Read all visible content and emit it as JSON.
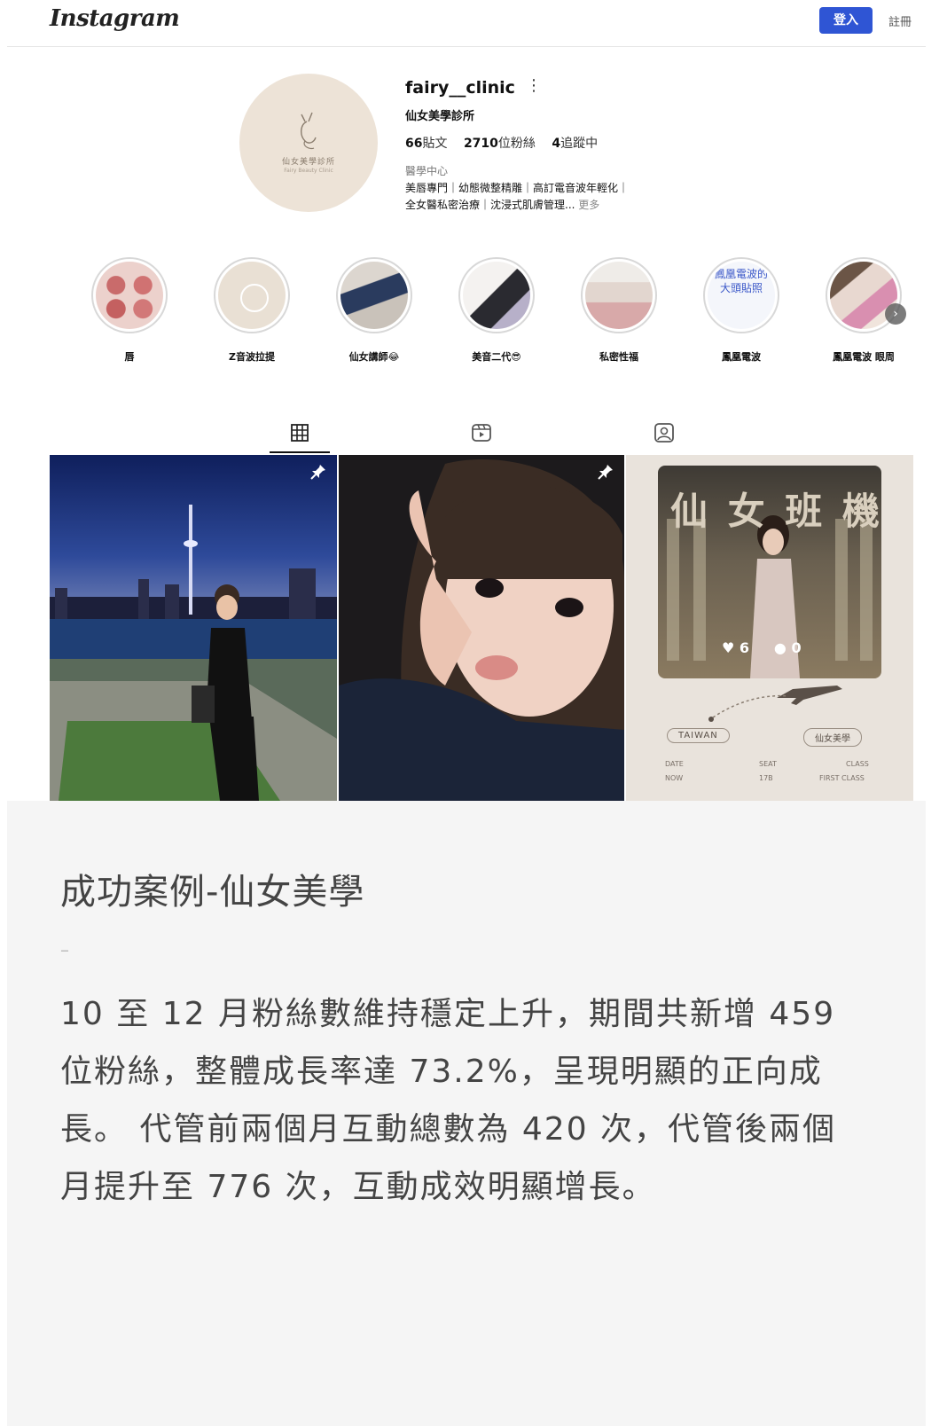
{
  "header": {
    "logo": "Instagram",
    "login_label": "登入",
    "signup_label": "註冊"
  },
  "profile": {
    "avatar_text": "仙女美學診所",
    "avatar_subtext": "Fairy Beauty Clinic",
    "username": "fairy__clinic",
    "display_name": "仙女美學診所",
    "stats": {
      "posts_count": "66",
      "posts_label": "貼文",
      "followers_count": "2710",
      "followers_label": "位粉絲",
      "following_count": "4",
      "following_label": "追蹤中"
    },
    "category": "醫學中心",
    "bio_line1": "美唇專門｜幼態微整精雕｜高訂電音波年輕化｜",
    "bio_line2": "全女醫私密治療｜沈浸式肌膚管理...",
    "bio_more": "更多"
  },
  "highlights": [
    {
      "label": "唇"
    },
    {
      "label": "Z音波拉提"
    },
    {
      "label": "仙女講師😂"
    },
    {
      "label": "美音二代😎"
    },
    {
      "label": "私密性福"
    },
    {
      "label": "鳳凰電波",
      "cover_text": "鳳凰電波的大頭貼照"
    },
    {
      "label": "鳳凰電波 眼周"
    }
  ],
  "posts": [
    {
      "pinned": true
    },
    {
      "pinned": true
    },
    {
      "pinned": false,
      "overlay_title": "仙 女 班 機",
      "likes": "6",
      "comments": "0",
      "ticket_from": "TAIWAN",
      "ticket_to": "仙女美學",
      "ticket_date_label": "DATE",
      "ticket_date_value": "NOW",
      "ticket_seat_label": "SEAT",
      "ticket_seat_value": "17B",
      "ticket_class_label": "CLASS",
      "ticket_class_value": "FIRST CLASS"
    }
  ],
  "caption": {
    "title": "成功案例-仙女美學",
    "divider": "–",
    "body": "10 至 12 月粉絲數維持穩定上升，期間共新增 459 位粉絲，整體成長率達 73.2%，呈現明顯的正向成長。 代管前兩個月互動總數為 420 次，代管後兩個月提升至 776 次，互動成效明顯增長。"
  },
  "colors": {
    "accent": "#2f55d4",
    "caption_bg": "#f5f5f5",
    "caption_text": "#444444",
    "avatar_bg": "#ede3d7"
  }
}
